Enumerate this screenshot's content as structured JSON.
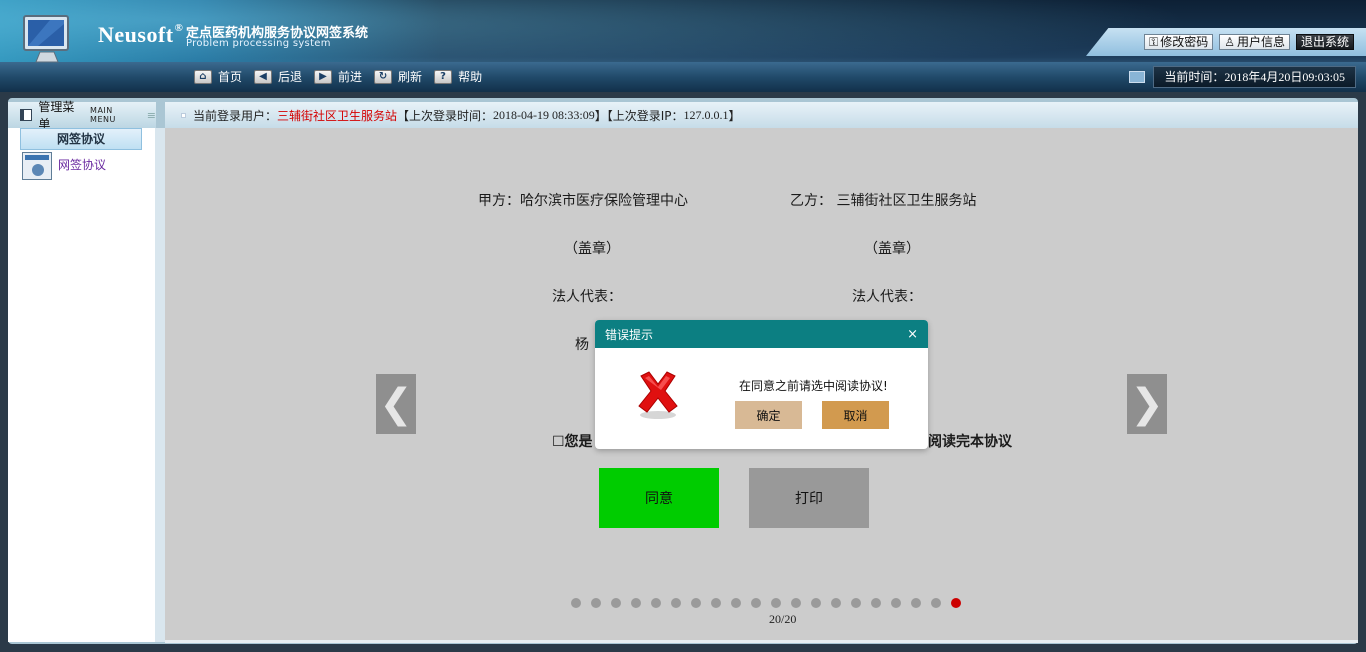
{
  "header": {
    "brand": "Neusoft",
    "brand_mark": "®",
    "system_title": "定点医药机构服务协议网签系统",
    "system_subtitle": "Problem processing system",
    "toolbar": [
      {
        "label": "首页",
        "icon": "home-icon"
      },
      {
        "label": "后退",
        "icon": "back-arrow-icon"
      },
      {
        "label": "前进",
        "icon": "forward-arrow-icon"
      },
      {
        "label": "刷新",
        "icon": "refresh-icon"
      },
      {
        "label": "帮助",
        "icon": "help-icon"
      }
    ],
    "account_buttons": {
      "change_password": "修改密码",
      "user_info": "用户信息",
      "logout": "退出系统"
    },
    "current_time": "当前时间：2018年4月20日09:03:05"
  },
  "sidebar": {
    "title": "管理菜单",
    "title_en": "MAIN MENU",
    "category": "网签协议",
    "items": [
      {
        "label": "网签协议",
        "icon": "document-user-icon"
      }
    ]
  },
  "infobar": {
    "login_user_label": "当前登录用户：",
    "login_user": "三辅街社区卫生服务站",
    "last_login_time_label": "【上次登录时间：",
    "last_login_time": "2018-04-19 08:33:09",
    "last_login_ip_label": "】【上次登录IP：",
    "last_login_ip": "127.0.0.1",
    "end_bracket": "】"
  },
  "agreement": {
    "party_a": "甲方：哈尔滨市医疗保险管理中心",
    "party_b": "乙方： 三辅街社区卫生服务站",
    "seal_a": "（盖章）",
    "seal_b": "（盖章）",
    "rep_a": "法人代表：",
    "rep_b": "法人代表：",
    "name_a_partial": "杨",
    "confirm_left_partial": "☐您是",
    "confirm_right_partial": "阅读完本协议",
    "agree_button": "同意",
    "print_button": "打印",
    "prev_arrow": "❮",
    "next_arrow": "❯",
    "page_current": 20,
    "page_total": 20,
    "pager": "20/20"
  },
  "modal": {
    "title": "错误提示",
    "close": "×",
    "message": "在同意之前请选中阅读协议!",
    "ok_button": "确定",
    "cancel_button": "取消",
    "icon": "error-x-icon"
  },
  "colors": {
    "agree_green": "#00cc00",
    "active_dot_red": "#cc0000",
    "modal_header_teal": "#0c7f82",
    "user_red": "#d40000"
  }
}
